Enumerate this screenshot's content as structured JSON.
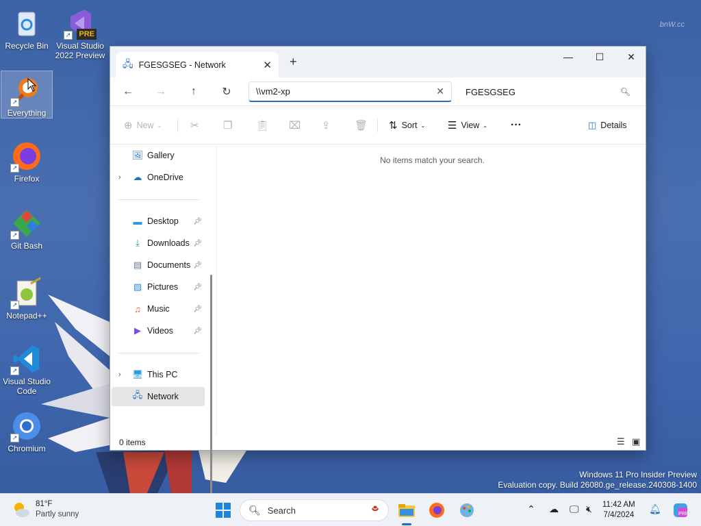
{
  "desktop": {
    "icons": [
      {
        "label": "Recycle Bin"
      },
      {
        "label": "Visual Studio 2022 Preview",
        "badge": "PRE"
      },
      {
        "label": "Everything"
      },
      {
        "label": "Firefox"
      },
      {
        "label": "Git Bash"
      },
      {
        "label": "Notepad++"
      },
      {
        "label": "Visual Studio Code"
      },
      {
        "label": "Chromium"
      }
    ],
    "watermark_line1": "Windows 11 Pro Insider Preview",
    "watermark_line2": "Evaluation copy. Build 26080.ge_release.240308-1400"
  },
  "window": {
    "tab_title": "FGESGSEG - Network",
    "address_value": "\\\\vm2-xp",
    "search_value": "FGESGSEG",
    "commands": {
      "new": "New",
      "sort": "Sort",
      "view": "View",
      "details": "Details"
    },
    "sidebar": [
      {
        "label": "Gallery"
      },
      {
        "label": "OneDrive"
      },
      {
        "label": "Desktop"
      },
      {
        "label": "Downloads"
      },
      {
        "label": "Documents"
      },
      {
        "label": "Pictures"
      },
      {
        "label": "Music"
      },
      {
        "label": "Videos"
      },
      {
        "label": "This PC"
      },
      {
        "label": "Network"
      }
    ],
    "empty_message": "No items match your search.",
    "status": "0 items"
  },
  "taskbar": {
    "weather_temp": "81°F",
    "weather_desc": "Partly sunny",
    "search_label": "Search",
    "time": "11:42 AM",
    "date": "7/4/2024",
    "accent": "#1a6ec0"
  }
}
